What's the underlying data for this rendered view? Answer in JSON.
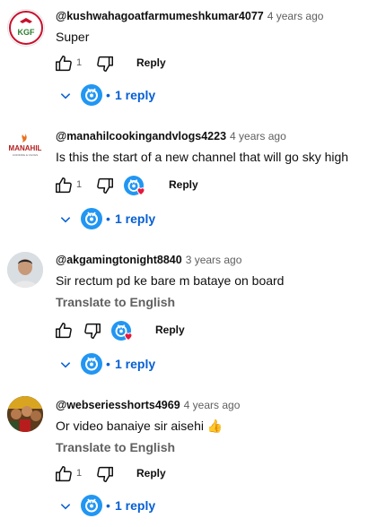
{
  "colors": {
    "link": "#065fd4",
    "muted": "#606060",
    "text": "#0f0f0f",
    "heart": "#e5173c"
  },
  "comments": [
    {
      "author": "@kushwahagoatfarmumeshkumar4077",
      "time": "4 years ago",
      "text": "Super",
      "like_count": "1",
      "reply_label": "Reply",
      "replies_label": "1 reply",
      "avatar_logo": "KGF",
      "avatar_icon": "kgf-logo-icon"
    },
    {
      "author": "@manahilcookingandvlogs4223",
      "time": "4 years ago",
      "text": "Is this the start of a new channel that will go sky high",
      "like_count": "1",
      "reply_label": "Reply",
      "replies_label": "1 reply",
      "avatar_logo": "MANAHIL",
      "avatar_sub": "COOKING & VLOGS",
      "avatar_icon": "manahil-logo-icon",
      "creator_heart": true
    },
    {
      "author": "@akgamingtonight8840",
      "time": "3 years ago",
      "text": "Sir rectum pd ke bare m bataye on board",
      "translate_label": "Translate to English",
      "reply_label": "Reply",
      "replies_label": "1 reply",
      "avatar_icon": "person-photo-icon",
      "creator_heart": true
    },
    {
      "author": "@webseriesshorts4969",
      "time": "4 years ago",
      "text": "Or video banaiye sir aisehi",
      "emoji": "👍",
      "translate_label": "Translate to English",
      "like_count": "1",
      "reply_label": "Reply",
      "replies_label": "1 reply",
      "avatar_icon": "group-photo-icon"
    }
  ]
}
